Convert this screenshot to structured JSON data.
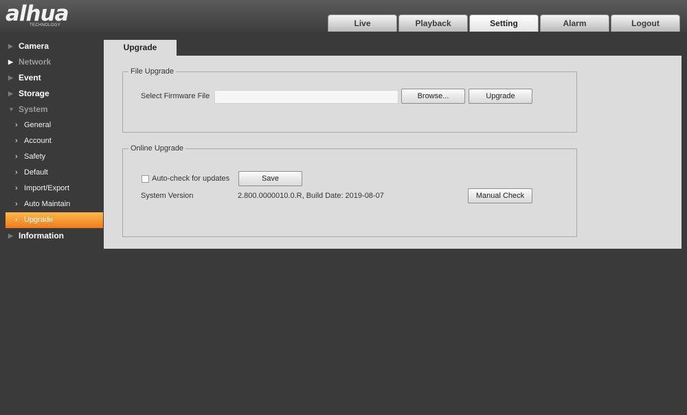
{
  "brand": {
    "logo_text": "alhua",
    "tagline": "TECHNOLOGY"
  },
  "top_tabs": [
    {
      "label": "Live"
    },
    {
      "label": "Playback"
    },
    {
      "label": "Setting"
    },
    {
      "label": "Alarm"
    },
    {
      "label": "Logout"
    }
  ],
  "active_top_tab": "Setting",
  "sidebar": {
    "items": [
      {
        "label": "Camera"
      },
      {
        "label": "Network"
      },
      {
        "label": "Event"
      },
      {
        "label": "Storage"
      },
      {
        "label": "System"
      },
      {
        "label": "General"
      },
      {
        "label": "Account"
      },
      {
        "label": "Safety"
      },
      {
        "label": "Default"
      },
      {
        "label": "Import/Export"
      },
      {
        "label": "Auto Maintain"
      },
      {
        "label": "Upgrade"
      },
      {
        "label": "Information"
      }
    ],
    "active_item": "Upgrade"
  },
  "page_tab": {
    "label": "Upgrade"
  },
  "file_upgrade": {
    "legend": "File Upgrade",
    "select_label": "Select Firmware File",
    "file_value": "",
    "browse_label": "Browse...",
    "upgrade_label": "Upgrade"
  },
  "online_upgrade": {
    "legend": "Online Upgrade",
    "auto_check_label": "Auto-check for updates",
    "auto_check_checked": false,
    "save_label": "Save",
    "system_version_label": "System Version",
    "system_version_value": "2.800.0000010.0.R, Build Date: 2019-08-07",
    "manual_check_label": "Manual Check"
  },
  "colors": {
    "background": "#3a3a3a",
    "panel": "#dcdcdc",
    "active_orange": "#f07a1c"
  }
}
